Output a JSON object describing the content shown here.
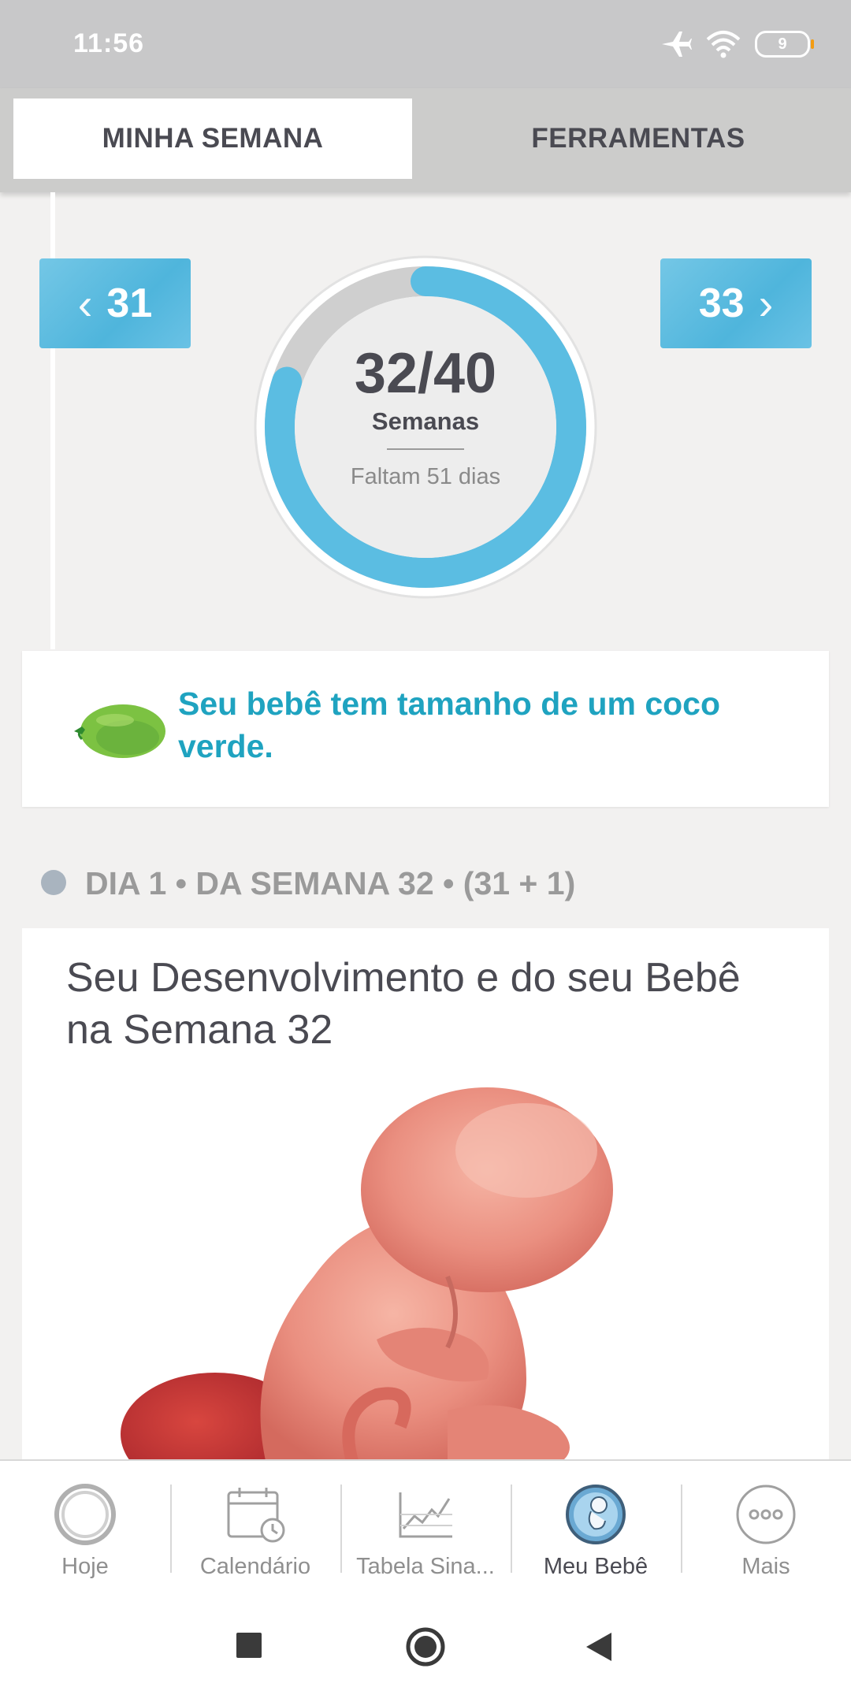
{
  "status_bar": {
    "time": "11:56",
    "battery": "9"
  },
  "tabs": [
    {
      "label": "MINHA SEMANA",
      "active": true
    },
    {
      "label": "FERRAMENTAS",
      "active": false
    }
  ],
  "week_nav": {
    "prev": "31",
    "next": "33"
  },
  "progress": {
    "value": "32/40",
    "label": "Semanas",
    "remaining": "Faltam 51 dias",
    "fraction": 0.8,
    "ring_color": "#5bbde2",
    "track_color": "#cfcfcf"
  },
  "size_card": {
    "text": "Seu bebê tem tamanho de um coco verde.",
    "icon": "coconut-icon"
  },
  "day_header": "DIA 1 • DA SEMANA 32 • (31 + 1)",
  "article": {
    "title": "Seu Desenvolvimento e do seu Bebê na Semana 32",
    "image": "fetus-illustration"
  },
  "bottom_nav": [
    {
      "label": "Hoje",
      "icon": "today-ring-icon",
      "active": false
    },
    {
      "label": "Calendário",
      "icon": "calendar-clock-icon",
      "active": false
    },
    {
      "label": "Tabela Sina...",
      "icon": "chart-icon",
      "active": false
    },
    {
      "label": "Meu Bebê",
      "icon": "baby-icon",
      "active": true
    },
    {
      "label": "Mais",
      "icon": "more-dots-icon",
      "active": false
    }
  ],
  "colors": {
    "accent": "#1fa3c0",
    "week_button": "#5bbde2",
    "text_dark": "#4a4a52"
  }
}
